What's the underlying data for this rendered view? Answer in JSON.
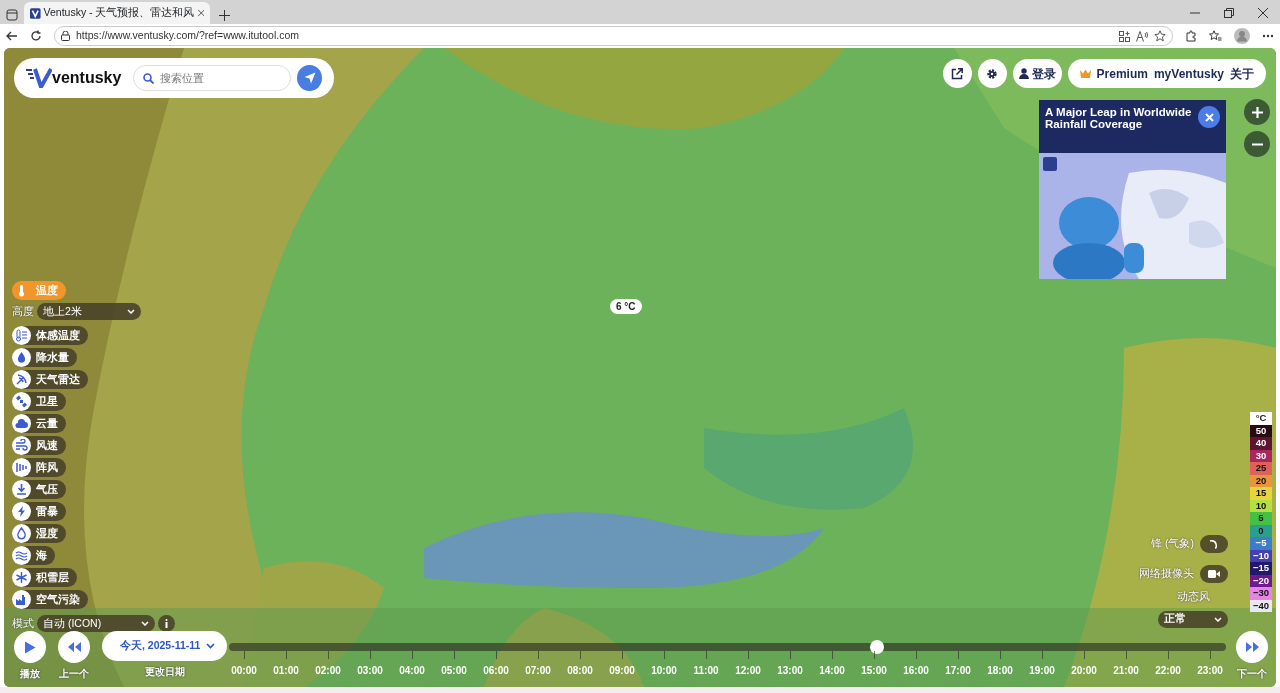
{
  "browser": {
    "tab_title": "Ventusky - 天气预报、雷达和风",
    "url": "https://www.ventusky.com/?ref=www.itutool.com"
  },
  "header": {
    "logo": "ventusky",
    "search": {
      "placeholder": "搜索位置"
    }
  },
  "top_right": {
    "login": "登录",
    "premium": "Premium",
    "my": "myVentusky",
    "about": "关于"
  },
  "news": {
    "title": "A Major Leap in Worldwide Rainfall Coverage"
  },
  "tooltip": "6 °C",
  "altitude": {
    "label": "高度",
    "value": "地上2米"
  },
  "layers": [
    {
      "label": "温度",
      "selected": true
    },
    {
      "label": "体感温度",
      "selected": false
    },
    {
      "label": "降水量",
      "selected": false
    },
    {
      "label": "天气雷达",
      "selected": false
    },
    {
      "label": "卫星",
      "selected": false
    },
    {
      "label": "云量",
      "selected": false
    },
    {
      "label": "风速",
      "selected": false
    },
    {
      "label": "阵风",
      "selected": false
    },
    {
      "label": "气压",
      "selected": false
    },
    {
      "label": "雷暴",
      "selected": false
    },
    {
      "label": "湿度",
      "selected": false
    },
    {
      "label": "海",
      "selected": false
    },
    {
      "label": "积雪层",
      "selected": false
    },
    {
      "label": "空气污染",
      "selected": false
    }
  ],
  "mode": {
    "label": "模式",
    "value": "自动 (ICON)"
  },
  "right_controls": {
    "fronts": "锋 (气象)",
    "fronts_on": false,
    "webcams": "网络摄像头",
    "webcams_on": false,
    "wind_label": "动态风",
    "wind_value": "正常"
  },
  "legend": {
    "unit": "°C",
    "items": [
      {
        "label": "50",
        "color": "#2a0a12"
      },
      {
        "label": "40",
        "color": "#5c1430"
      },
      {
        "label": "30",
        "color": "#a8285e"
      },
      {
        "label": "25",
        "color": "#e0605a"
      },
      {
        "label": "20",
        "color": "#e8963a"
      },
      {
        "label": "15",
        "color": "#e8d43c"
      },
      {
        "label": "10",
        "color": "#b4e040"
      },
      {
        "label": "5",
        "color": "#44c044"
      },
      {
        "label": "0",
        "color": "#2aa08c"
      },
      {
        "label": "−5",
        "color": "#3c7cc8"
      },
      {
        "label": "−10",
        "color": "#4440b0"
      },
      {
        "label": "−15",
        "color": "#22186c"
      },
      {
        "label": "−20",
        "color": "#701890"
      },
      {
        "label": "−30",
        "color": "#e484e4"
      },
      {
        "label": "−40",
        "color": "#e8e8f0"
      }
    ]
  },
  "timeline": {
    "play": "播放",
    "prev": "上一个",
    "date": "今天, 2025-11-11",
    "change_date": "更改日期",
    "next": "下一个",
    "level": 0.65,
    "hours": [
      "00:00",
      "01:00",
      "02:00",
      "03:00",
      "04:00",
      "05:00",
      "06:00",
      "07:00",
      "08:00",
      "09:00",
      "10:00",
      "11:00",
      "12:00",
      "13:00",
      "14:00",
      "15:00",
      "16:00",
      "17:00",
      "18:00",
      "19:00",
      "20:00",
      "21:00",
      "22:00",
      "23:00"
    ]
  }
}
